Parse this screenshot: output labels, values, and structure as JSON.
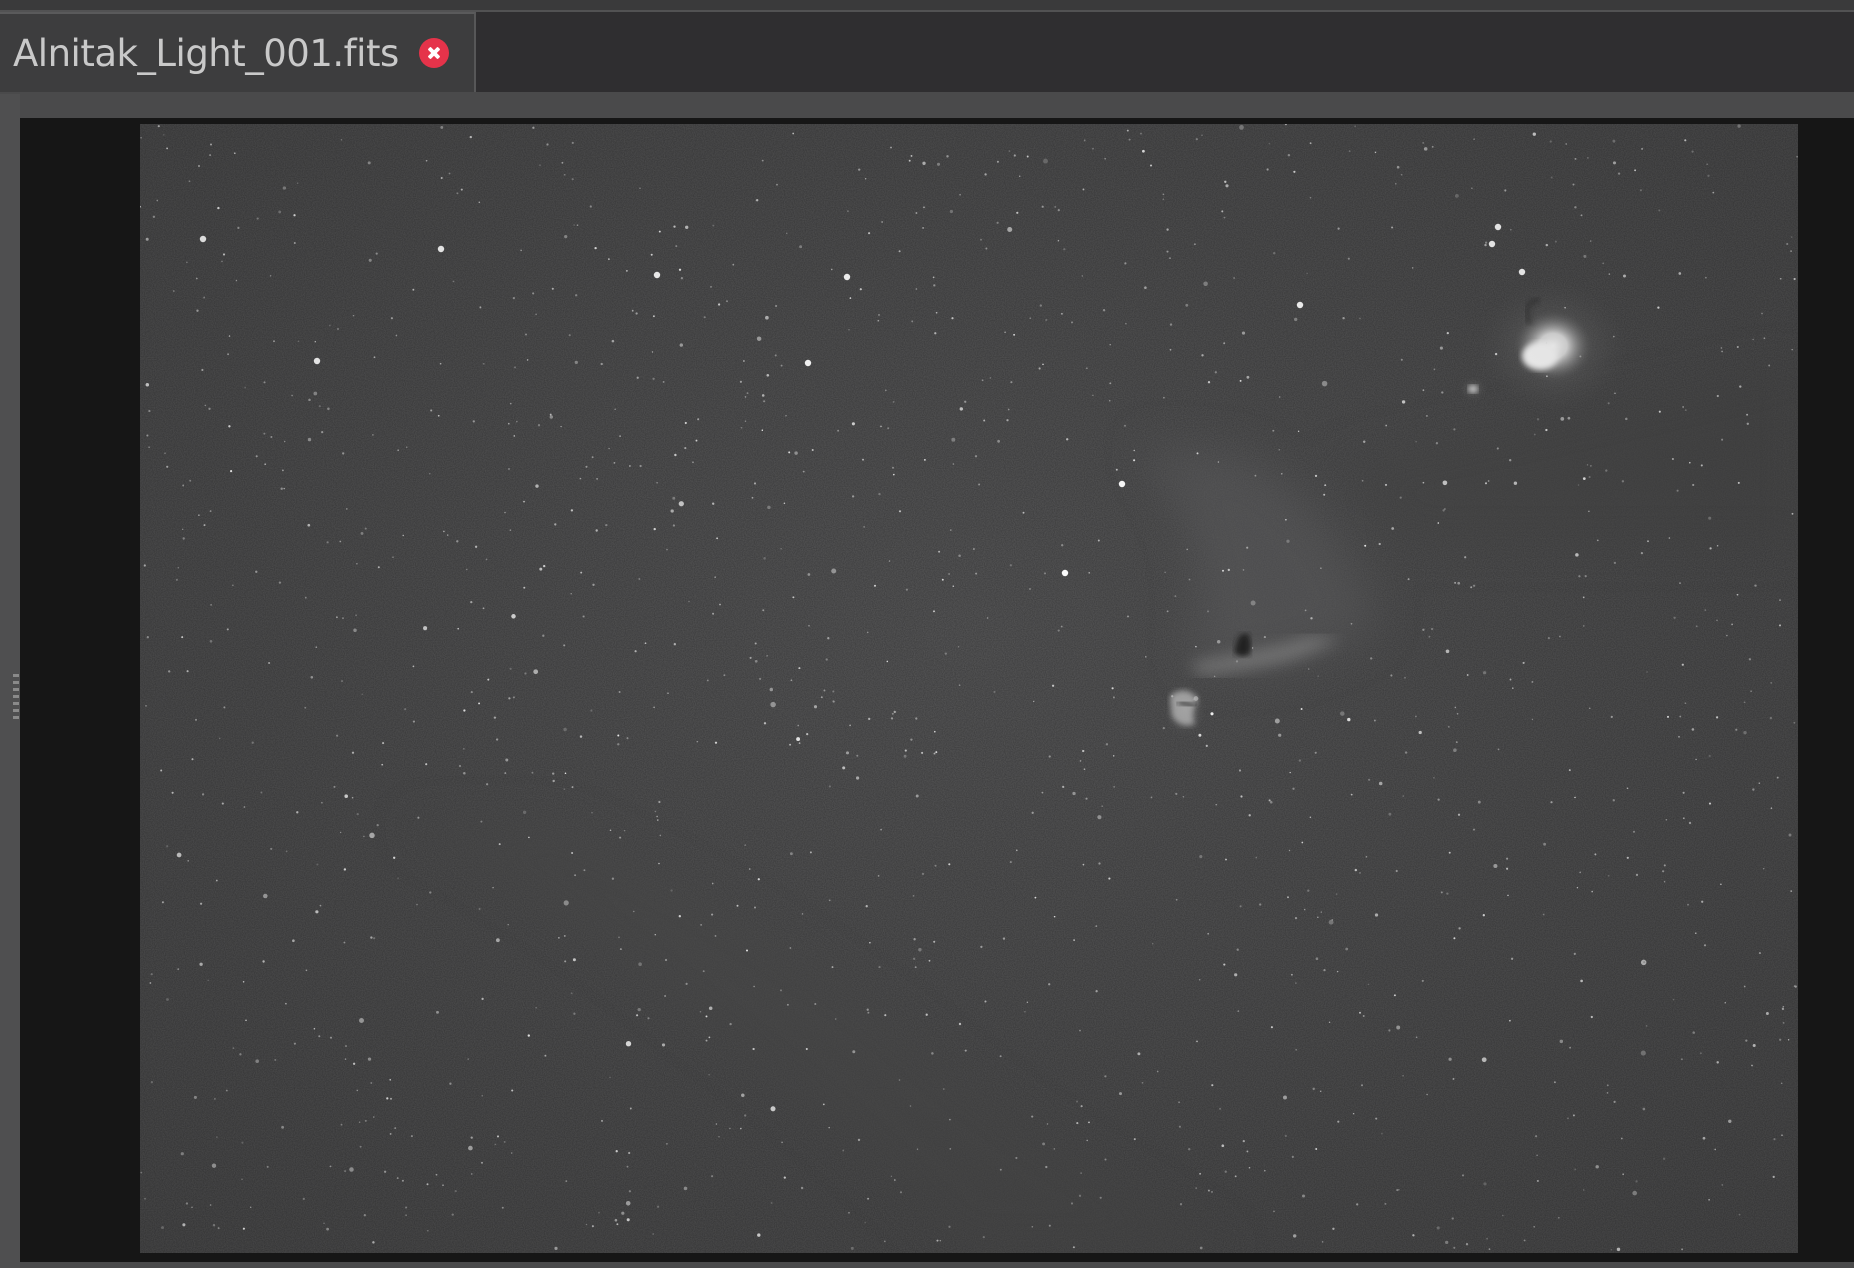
{
  "tab": {
    "title": "Alnitak_Light_001.fits",
    "close_icon": "close-circle-icon",
    "close_color": "#e5334a"
  },
  "viewer": {
    "image_subject": "Alnitak region: Horsehead and Flame nebulae, Orion Nebula",
    "background_color": "#161616"
  }
}
